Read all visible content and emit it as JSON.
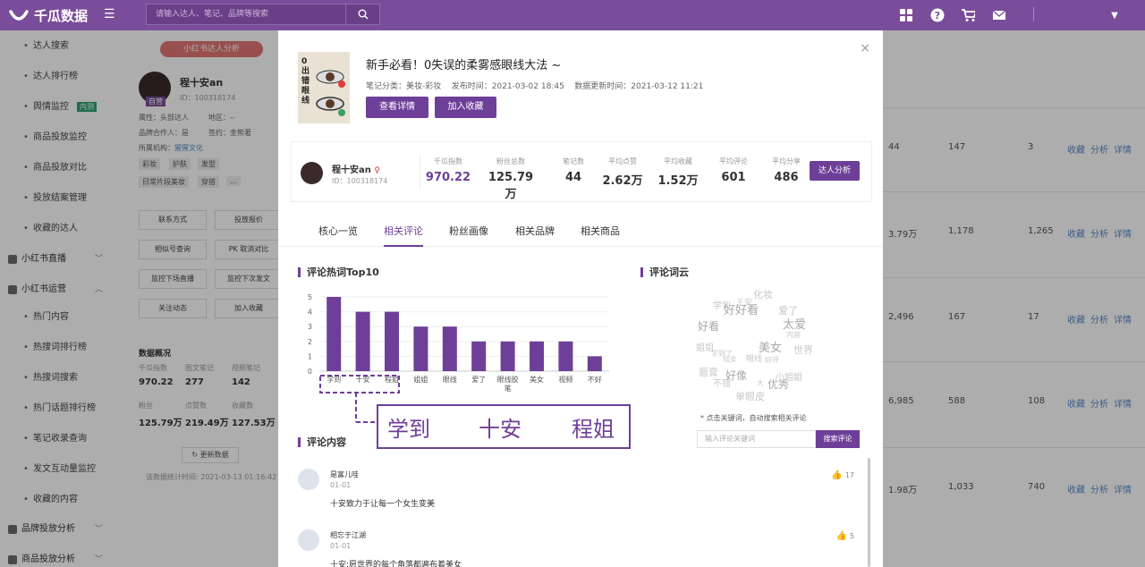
{
  "app": {
    "brand": "千瓜数据",
    "search_placeholder": "请输入达人、笔记、品牌等搜索"
  },
  "sidebar": {
    "items": [
      {
        "label": "达人搜索",
        "type": "sub"
      },
      {
        "label": "达人排行榜",
        "type": "sub"
      },
      {
        "label": "舆情监控",
        "type": "sub",
        "badge": "内测"
      },
      {
        "label": "商品投放监控",
        "type": "sub"
      },
      {
        "label": "商品投放对比",
        "type": "sub"
      },
      {
        "label": "投放结案管理",
        "type": "sub"
      },
      {
        "label": "收藏的达人",
        "type": "sub"
      },
      {
        "label": "小红书直播",
        "type": "group"
      },
      {
        "label": "小红书运营",
        "type": "group"
      },
      {
        "label": "热门内容",
        "type": "sub"
      },
      {
        "label": "热搜词排行榜",
        "type": "sub"
      },
      {
        "label": "热搜词搜索",
        "type": "sub"
      },
      {
        "label": "热门话题排行榜",
        "type": "sub"
      },
      {
        "label": "笔记收录查询",
        "type": "sub"
      },
      {
        "label": "发文互动量监控",
        "type": "sub"
      },
      {
        "label": "收藏的内容",
        "type": "sub"
      },
      {
        "label": "品牌投放分析",
        "type": "group"
      },
      {
        "label": "商品投放分析",
        "type": "group"
      }
    ]
  },
  "profile": {
    "tag": "小红书达人分析",
    "name": "程十安an",
    "id": "ID：100318174",
    "avatar_badge": "自营",
    "attr1": "属性：头部达人",
    "region": "地区：--",
    "brand_partner": "品牌合作人：是",
    "sign": "签约：金熊著",
    "org": "所属机构：",
    "org_link": "猩猩文化",
    "tags": [
      "彩妆",
      "护肤",
      "发型",
      "日常片段美妆",
      "穿搭",
      "..."
    ],
    "buttons": [
      "联系方式",
      "投放报价",
      "相似号查询",
      "PK 取消对比",
      "监控下场直播",
      "监控下次发文",
      "关注动态",
      "加入收藏"
    ],
    "overview_title": "数据概况",
    "overview": [
      {
        "label": "千瓜指数",
        "value": "970.22"
      },
      {
        "label": "图文笔记",
        "value": "277"
      },
      {
        "label": "视频笔记",
        "value": "142"
      },
      {
        "label": "粉丝",
        "value": "125.79万"
      },
      {
        "label": "点赞数",
        "value": "219.49万"
      },
      {
        "label": "收藏数",
        "value": "127.53万"
      }
    ],
    "update_btn": "更新数据",
    "update_time": "该数据统计时间: 2021-03-13 01:16:42"
  },
  "right_rows": [
    {
      "a": "44",
      "b": "147",
      "c": "3"
    },
    {
      "a": "3.79万",
      "b": "1,178",
      "c": "1,265"
    },
    {
      "a": "2,496",
      "b": "167",
      "c": "17"
    },
    {
      "a": "6,985",
      "b": "588",
      "c": "108"
    },
    {
      "a": "1.98万",
      "b": "1,033",
      "c": "740"
    }
  ],
  "right_links": [
    "收藏",
    "分析",
    "详情"
  ],
  "modal": {
    "cover_text": "0出错眼线",
    "note_title": "新手必看！0失误的柔雾感眼线大法 ~",
    "category": "笔记分类：美妆-彩妆",
    "publish_time": "发布时间：2021-03-02 18:45",
    "update_time": "数据更新时间：2021-03-12 11:21",
    "view_btn": "查看详情",
    "fav_btn": "加入收藏",
    "author": {
      "name": "程十安an",
      "id": "ID：100318174"
    },
    "stats": [
      {
        "label": "千瓜指数",
        "value": "970.22"
      },
      {
        "label": "粉丝总数",
        "value": "125.79万"
      },
      {
        "label": "笔记数",
        "value": "44"
      },
      {
        "label": "平均点赞",
        "value": "2.62万"
      },
      {
        "label": "平均收藏",
        "value": "1.52万"
      },
      {
        "label": "平均评论",
        "value": "601"
      },
      {
        "label": "平均分享",
        "value": "486"
      }
    ],
    "analyze_btn": "达人分析",
    "tabs": [
      "核心一览",
      "相关评论",
      "粉丝画像",
      "相关品牌",
      "相关商品"
    ],
    "active_tab": 1,
    "hotwords_title": "评论热词Top10",
    "wordcloud_title": "评论词云",
    "wordcloud": [
      "学到",
      "化妆",
      "王安",
      "好好看",
      "爱了",
      "太爱",
      "好看",
      "内容",
      "姐姐",
      "美女",
      "世界",
      "仙女",
      "唇膏",
      "好像",
      "小姐姐",
      "不错",
      "大",
      "优秀",
      "单眼皮",
      "眼线",
      "学到了",
      "好评"
    ],
    "hint": "* 点击关键词，自动搜索相关评论",
    "kw_placeholder": "输入评论关键词",
    "kw_btn": "搜索评论",
    "zoom_words": [
      "学到",
      "十安",
      "程姐"
    ],
    "comments_title": "评论内容",
    "comments": [
      {
        "name": "是富儿哇",
        "date": "01-01",
        "text": "十安致力于让每一个女生变美",
        "likes": "17"
      },
      {
        "name": "相忘于江湖",
        "date": "01-01",
        "text": "十安:愿世界的每个角落都遍布着美女",
        "likes": "5"
      }
    ]
  },
  "chart_data": {
    "type": "bar",
    "title": "评论热词Top10",
    "categories": [
      "学到",
      "十安",
      "程姐",
      "姐姐",
      "眼线",
      "爱了",
      "眼线胶笔",
      "美女",
      "视频",
      "不好"
    ],
    "values": [
      5,
      4,
      4,
      3,
      3,
      2,
      2,
      2,
      2,
      1
    ],
    "ylim": [
      0,
      5
    ],
    "yticks": [
      "0",
      "1",
      "2",
      "3",
      "4",
      "5"
    ],
    "grid": true,
    "color": "#6e3f98"
  }
}
